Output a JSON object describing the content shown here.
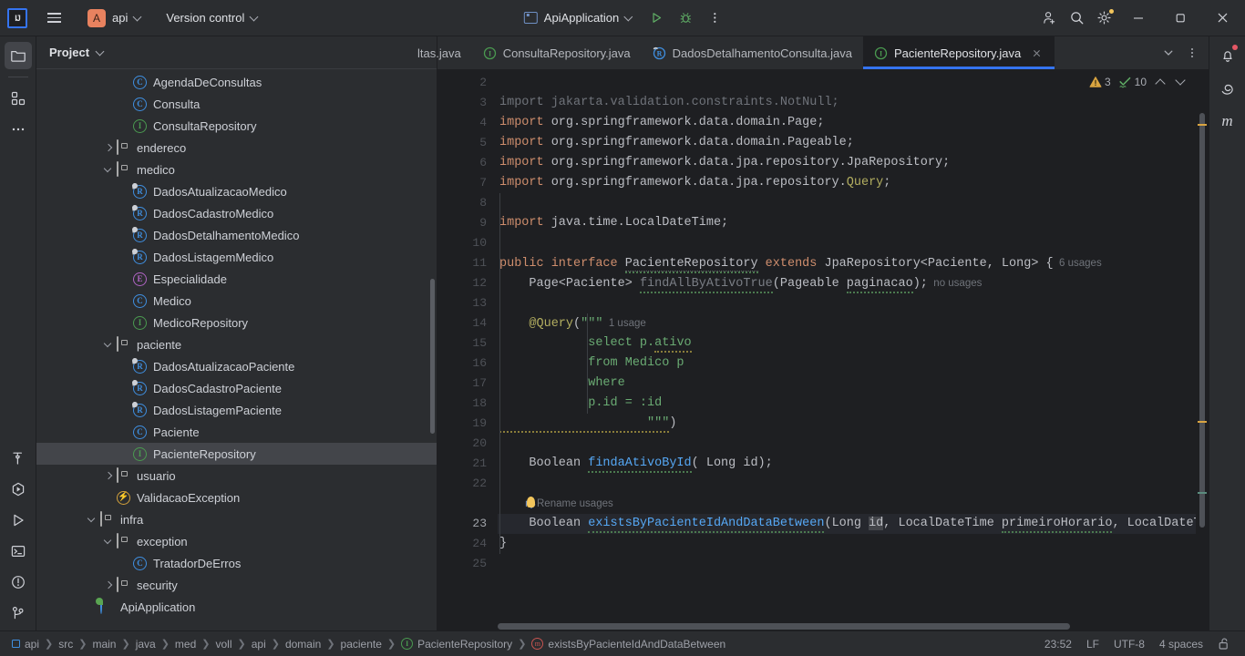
{
  "titlebar": {
    "logo_text": "IJ",
    "project_badge": "A",
    "project_name": "api",
    "version_control": "Version control",
    "run_config": "ApiApplication",
    "icons": {
      "hamburger": "hamburger-menu-icon",
      "run": "run-icon",
      "debug": "debug-icon",
      "more": "more-options-icon",
      "add_user": "add-user-icon",
      "search": "search-icon",
      "settings": "settings-gear-icon",
      "minimize": "minimize-icon",
      "maximize": "maximize-icon",
      "close": "close-icon"
    }
  },
  "left_stripe": [
    {
      "name": "project-tool-window",
      "icon": "folder-icon",
      "active": true
    },
    {
      "name": "structure-tool-window",
      "icon": "structure-icon",
      "active": false
    },
    {
      "name": "more-tool-windows",
      "icon": "ellipsis-icon",
      "active": false
    },
    {
      "name": "build-tool-window",
      "icon": "hammer-icon",
      "active": false
    },
    {
      "name": "coverage-tool-window",
      "icon": "run-coverage-icon",
      "active": false
    },
    {
      "name": "run-tool-window",
      "icon": "play-icon",
      "active": false
    },
    {
      "name": "terminal-tool-window",
      "icon": "terminal-icon",
      "active": false
    },
    {
      "name": "problems-tool-window",
      "icon": "problems-icon",
      "active": false
    },
    {
      "name": "version-control-tool-window",
      "icon": "git-branch-icon",
      "active": false
    }
  ],
  "right_stripe": [
    {
      "name": "notifications",
      "icon": "bell-icon",
      "badge": true
    },
    {
      "name": "spiral-tool",
      "icon": "spiral-icon",
      "badge": false
    },
    {
      "name": "maven-tool-window",
      "icon": "maven-m-icon",
      "badge": false
    }
  ],
  "project_panel": {
    "title": "Project",
    "tree": [
      {
        "indent": 4,
        "arrow": "none",
        "icon": "class",
        "label": "AgendaDeConsultas",
        "selected": false
      },
      {
        "indent": 4,
        "arrow": "none",
        "icon": "class",
        "label": "Consulta",
        "selected": false
      },
      {
        "indent": 4,
        "arrow": "none",
        "icon": "interface",
        "label": "ConsultaRepository",
        "selected": false
      },
      {
        "indent": 3,
        "arrow": "right",
        "icon": "folder",
        "label": "endereco",
        "selected": false
      },
      {
        "indent": 3,
        "arrow": "down",
        "icon": "folder",
        "label": "medico",
        "selected": false
      },
      {
        "indent": 4,
        "arrow": "none",
        "icon": "record",
        "label": "DadosAtualizacaoMedico",
        "selected": false
      },
      {
        "indent": 4,
        "arrow": "none",
        "icon": "record",
        "label": "DadosCadastroMedico",
        "selected": false
      },
      {
        "indent": 4,
        "arrow": "none",
        "icon": "record",
        "label": "DadosDetalhamentoMedico",
        "selected": false
      },
      {
        "indent": 4,
        "arrow": "none",
        "icon": "record",
        "label": "DadosListagemMedico",
        "selected": false
      },
      {
        "indent": 4,
        "arrow": "none",
        "icon": "enum",
        "label": "Especialidade",
        "selected": false
      },
      {
        "indent": 4,
        "arrow": "none",
        "icon": "class",
        "label": "Medico",
        "selected": false
      },
      {
        "indent": 4,
        "arrow": "none",
        "icon": "interface",
        "label": "MedicoRepository",
        "selected": false
      },
      {
        "indent": 3,
        "arrow": "down",
        "icon": "folder",
        "label": "paciente",
        "selected": false
      },
      {
        "indent": 4,
        "arrow": "none",
        "icon": "record",
        "label": "DadosAtualizacaoPaciente",
        "selected": false
      },
      {
        "indent": 4,
        "arrow": "none",
        "icon": "record",
        "label": "DadosCadastroPaciente",
        "selected": false
      },
      {
        "indent": 4,
        "arrow": "none",
        "icon": "record",
        "label": "DadosListagemPaciente",
        "selected": false
      },
      {
        "indent": 4,
        "arrow": "none",
        "icon": "class",
        "label": "Paciente",
        "selected": false
      },
      {
        "indent": 4,
        "arrow": "none",
        "icon": "interface",
        "label": "PacienteRepository",
        "selected": true
      },
      {
        "indent": 3,
        "arrow": "right",
        "icon": "folder",
        "label": "usuario",
        "selected": false
      },
      {
        "indent": 3,
        "arrow": "none",
        "icon": "exception",
        "label": "ValidacaoException",
        "selected": false
      },
      {
        "indent": 2,
        "arrow": "down",
        "icon": "folder",
        "label": "infra",
        "selected": false
      },
      {
        "indent": 3,
        "arrow": "down",
        "icon": "folder",
        "label": "exception",
        "selected": false
      },
      {
        "indent": 4,
        "arrow": "none",
        "icon": "class",
        "label": "TratadorDeErros",
        "selected": false
      },
      {
        "indent": 3,
        "arrow": "right",
        "icon": "folder",
        "label": "security",
        "selected": false
      },
      {
        "indent": 2,
        "arrow": "none",
        "icon": "spring",
        "label": "ApiApplication",
        "selected": false
      }
    ]
  },
  "editor_tabs": [
    {
      "label": "ltas.java",
      "icon": "none",
      "active": false,
      "clipped": true
    },
    {
      "label": "ConsultaRepository.java",
      "icon": "interface",
      "active": false,
      "clipped": false
    },
    {
      "label": "DadosDetalhamentoConsulta.java",
      "icon": "record",
      "active": false,
      "clipped": false
    },
    {
      "label": "PacienteRepository.java",
      "icon": "interface",
      "active": true,
      "clipped": false
    }
  ],
  "tab_actions": {
    "close": "close-tab-icon",
    "dropdown": "tab-list-dropdown-icon",
    "options": "tab-options-icon"
  },
  "inspections": {
    "warning_count": "3",
    "weak_warning_count": "10",
    "prev_label": "previous-highlight",
    "next_label": "next-highlight"
  },
  "code": {
    "first_line": 2,
    "lines": [
      {
        "n": 2,
        "text": ""
      },
      {
        "n": 3,
        "text": "import jakarta.validation.constraints.NotNull;"
      },
      {
        "n": 4,
        "text": "import org.springframework.data.domain.Page;"
      },
      {
        "n": 5,
        "text": "import org.springframework.data.domain.Pageable;"
      },
      {
        "n": 6,
        "text": "import org.springframework.data.jpa.repository.JpaRepository;"
      },
      {
        "n": 7,
        "text": "import org.springframework.data.jpa.repository.Query;"
      },
      {
        "n": 8,
        "text": ""
      },
      {
        "n": 9,
        "text": "import java.time.LocalDateTime;"
      },
      {
        "n": 10,
        "text": ""
      },
      {
        "n": 11,
        "text": "public interface PacienteRepository extends JpaRepository<Paciente, Long> {"
      },
      {
        "n": 12,
        "text": "    Page<Paciente> findAllByAtivoTrue(Pageable paginacao);"
      },
      {
        "n": 13,
        "text": ""
      },
      {
        "n": 14,
        "text": "    @Query(\"\"\""
      },
      {
        "n": 15,
        "text": "            select p.ativo"
      },
      {
        "n": 16,
        "text": "            from Medico p"
      },
      {
        "n": 17,
        "text": "            where"
      },
      {
        "n": 18,
        "text": "            p.id = :id"
      },
      {
        "n": 19,
        "text": "                    \"\"\")"
      },
      {
        "n": 20,
        "text": ""
      },
      {
        "n": 21,
        "text": "    Boolean findaAtivoById( Long id);"
      },
      {
        "n": 22,
        "text": ""
      },
      {
        "n": 23,
        "text": "    Boolean existsByPacienteIdAndDataBetween(Long id, LocalDateTime primeiroHorario, LocalDateTim"
      },
      {
        "n": 24,
        "text": "}"
      },
      {
        "n": 25,
        "text": ""
      }
    ],
    "inlay_hints": {
      "class_usages": "6 usages",
      "find_all_usages": "no usages",
      "query_usages": "1 usage",
      "rename_usages": "Rename usages"
    }
  },
  "status_bar": {
    "breadcrumbs": [
      {
        "label": "api",
        "icon": "module-icon"
      },
      {
        "label": "src",
        "icon": "none"
      },
      {
        "label": "main",
        "icon": "none"
      },
      {
        "label": "java",
        "icon": "none"
      },
      {
        "label": "med",
        "icon": "none"
      },
      {
        "label": "voll",
        "icon": "none"
      },
      {
        "label": "api",
        "icon": "none"
      },
      {
        "label": "domain",
        "icon": "none"
      },
      {
        "label": "paciente",
        "icon": "none"
      },
      {
        "label": "PacienteRepository",
        "icon": "interface-icon"
      },
      {
        "label": "existsByPacienteIdAndDataBetween",
        "icon": "method-icon"
      }
    ],
    "caret_position": "23:52",
    "line_separator": "LF",
    "encoding": "UTF-8",
    "indent": "4 spaces",
    "lock_icon": "unlocked-padlock-icon"
  },
  "colors": {
    "accent": "#3574f0",
    "keyword": "#cf8e6d",
    "string": "#6aab73",
    "annotation": "#b3ae60",
    "method": "#56a8f5",
    "warning": "#f2c55c",
    "bg_editor": "#1e1f22",
    "bg_panel": "#2b2d30"
  }
}
